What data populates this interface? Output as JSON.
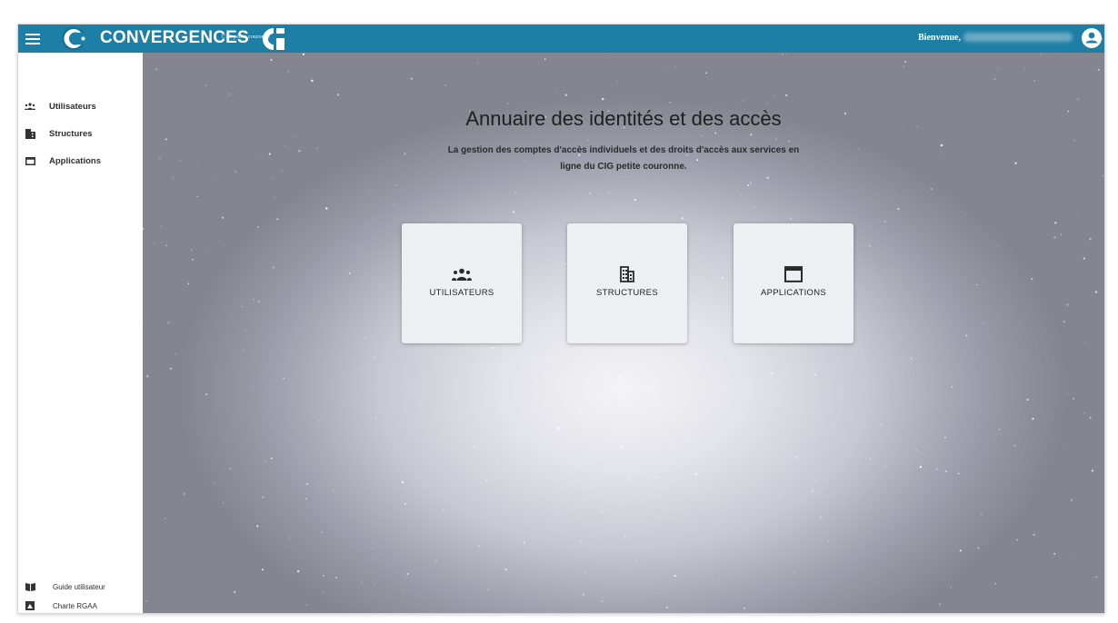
{
  "header": {
    "brand": "CONVERGENCES",
    "brand_sub": "CIG petite couronne",
    "welcome_label": "Bienvenue,",
    "colors": {
      "bar": "#1d7ea6",
      "text": "#ffffff"
    }
  },
  "sidebar": {
    "items": [
      {
        "label": "Utilisateurs",
        "icon": "people-icon"
      },
      {
        "label": "Structures",
        "icon": "building-icon"
      },
      {
        "label": "Applications",
        "icon": "window-icon"
      }
    ],
    "footer": [
      {
        "label": "Guide utilisateur",
        "icon": "book-icon"
      },
      {
        "label": "Charte RGAA",
        "icon": "accessibility-icon"
      }
    ]
  },
  "main": {
    "title": "Annuaire des identités et des accès",
    "subtitle": "La gestion des comptes d'accès individuels et des droits d'accès aux services en ligne du CIG petite couronne.",
    "cards": [
      {
        "label": "UTILISATEURS",
        "icon": "people-icon"
      },
      {
        "label": "STRUCTURES",
        "icon": "building-icon"
      },
      {
        "label": "APPLICATIONS",
        "icon": "window-icon"
      }
    ]
  }
}
